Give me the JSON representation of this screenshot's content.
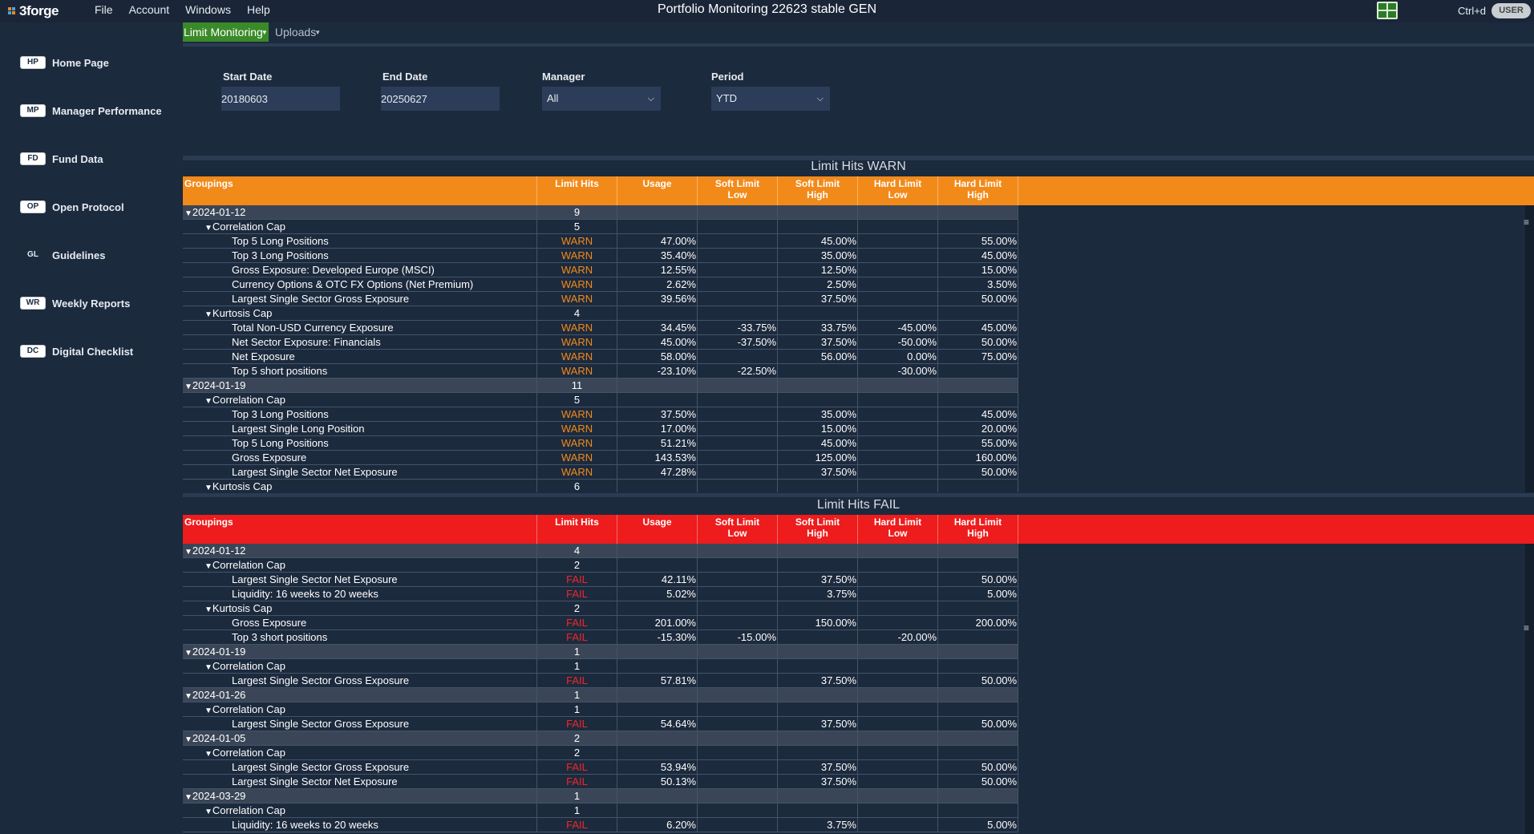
{
  "app": {
    "logo_text": "3forge",
    "title": "Portfolio Monitoring 22623 stable GEN",
    "menu": [
      "File",
      "Account",
      "Windows",
      "Help"
    ],
    "shortcut": "Ctrl+d",
    "user_label": "USER"
  },
  "sidebar": {
    "items": [
      {
        "badge": "HP",
        "label": "Home Page"
      },
      {
        "badge": "MP",
        "label": "Manager Performance"
      },
      {
        "badge": "FD",
        "label": "Fund Data"
      },
      {
        "badge": "OP",
        "label": "Open Protocol"
      },
      {
        "badge": "GL",
        "label": "Guidelines"
      },
      {
        "badge": "WR",
        "label": "Weekly Reports"
      },
      {
        "badge": "DC",
        "label": "Digital Checklist"
      }
    ]
  },
  "tabs": [
    {
      "label": "Limit Monitoring",
      "active": true
    },
    {
      "label": "Uploads",
      "active": false
    }
  ],
  "filters": {
    "start_date_label": "Start Date",
    "start_date": "20180603",
    "end_date_label": "End Date",
    "end_date": "20250627",
    "manager_label": "Manager",
    "manager": "All",
    "period_label": "Period",
    "period": "YTD"
  },
  "colors": {
    "warn_header": "#f28a1a",
    "fail_header": "#ee1c1c",
    "background": "#1c2a3d"
  },
  "columns": [
    "Groupings",
    "Limit Hits",
    "Usage",
    "Soft Limit\nLow",
    "Soft Limit\nHigh",
    "Hard Limit\nLow",
    "Hard Limit\nHigh"
  ],
  "warn": {
    "title": "Limit Hits WARN",
    "rows": [
      {
        "level": 0,
        "name": "2024-01-12",
        "hits": "9"
      },
      {
        "level": 1,
        "name": "Correlation Cap",
        "hits": "5"
      },
      {
        "level": 2,
        "name": "Top 5 Long Positions",
        "hits": "WARN",
        "usage": "47.00%",
        "sll": "",
        "slh": "45.00%",
        "hll": "",
        "hlh": "55.00%"
      },
      {
        "level": 2,
        "name": "Top 3 Long Positions",
        "hits": "WARN",
        "usage": "35.40%",
        "sll": "",
        "slh": "35.00%",
        "hll": "",
        "hlh": "45.00%"
      },
      {
        "level": 2,
        "name": "Gross Exposure: Developed Europe (MSCI)",
        "hits": "WARN",
        "usage": "12.55%",
        "sll": "",
        "slh": "12.50%",
        "hll": "",
        "hlh": "15.00%"
      },
      {
        "level": 2,
        "name": "Currency Options & OTC FX Options (Net Premium)",
        "hits": "WARN",
        "usage": "2.62%",
        "sll": "",
        "slh": "2.50%",
        "hll": "",
        "hlh": "3.50%"
      },
      {
        "level": 2,
        "name": "Largest Single Sector Gross Exposure",
        "hits": "WARN",
        "usage": "39.56%",
        "sll": "",
        "slh": "37.50%",
        "hll": "",
        "hlh": "50.00%"
      },
      {
        "level": 1,
        "name": "Kurtosis Cap",
        "hits": "4"
      },
      {
        "level": 2,
        "name": "Total Non-USD Currency Exposure",
        "hits": "WARN",
        "usage": "34.45%",
        "sll": "-33.75%",
        "slh": "33.75%",
        "hll": "-45.00%",
        "hlh": "45.00%"
      },
      {
        "level": 2,
        "name": "Net Sector Exposure: Financials",
        "hits": "WARN",
        "usage": "45.00%",
        "sll": "-37.50%",
        "slh": "37.50%",
        "hll": "-50.00%",
        "hlh": "50.00%"
      },
      {
        "level": 2,
        "name": "Net Exposure",
        "hits": "WARN",
        "usage": "58.00%",
        "sll": "",
        "slh": "56.00%",
        "hll": "0.00%",
        "hlh": "75.00%"
      },
      {
        "level": 2,
        "name": "Top 5 short positions",
        "hits": "WARN",
        "usage": "-23.10%",
        "sll": "-22.50%",
        "slh": "",
        "hll": "-30.00%",
        "hlh": ""
      },
      {
        "level": 0,
        "name": "2024-01-19",
        "hits": "11"
      },
      {
        "level": 1,
        "name": "Correlation Cap",
        "hits": "5"
      },
      {
        "level": 2,
        "name": "Top 3 Long Positions",
        "hits": "WARN",
        "usage": "37.50%",
        "sll": "",
        "slh": "35.00%",
        "hll": "",
        "hlh": "45.00%"
      },
      {
        "level": 2,
        "name": "Largest Single Long Position",
        "hits": "WARN",
        "usage": "17.00%",
        "sll": "",
        "slh": "15.00%",
        "hll": "",
        "hlh": "20.00%"
      },
      {
        "level": 2,
        "name": "Top 5 Long Positions",
        "hits": "WARN",
        "usage": "51.21%",
        "sll": "",
        "slh": "45.00%",
        "hll": "",
        "hlh": "55.00%"
      },
      {
        "level": 2,
        "name": "Gross Exposure",
        "hits": "WARN",
        "usage": "143.53%",
        "sll": "",
        "slh": "125.00%",
        "hll": "",
        "hlh": "160.00%"
      },
      {
        "level": 2,
        "name": "Largest Single Sector Net Exposure",
        "hits": "WARN",
        "usage": "47.28%",
        "sll": "",
        "slh": "37.50%",
        "hll": "",
        "hlh": "50.00%"
      },
      {
        "level": 1,
        "name": "Kurtosis Cap",
        "hits": "6"
      }
    ]
  },
  "fail": {
    "title": "Limit Hits FAIL",
    "rows": [
      {
        "level": 0,
        "name": "2024-01-12",
        "hits": "4"
      },
      {
        "level": 1,
        "name": "Correlation Cap",
        "hits": "2"
      },
      {
        "level": 2,
        "name": "Largest Single Sector Net Exposure",
        "hits": "FAIL",
        "usage": "42.11%",
        "sll": "",
        "slh": "37.50%",
        "hll": "",
        "hlh": "50.00%"
      },
      {
        "level": 2,
        "name": "Liquidity: 16 weeks to 20 weeks",
        "hits": "FAIL",
        "usage": "5.02%",
        "sll": "",
        "slh": "3.75%",
        "hll": "",
        "hlh": "5.00%"
      },
      {
        "level": 1,
        "name": "Kurtosis Cap",
        "hits": "2"
      },
      {
        "level": 2,
        "name": "Gross Exposure",
        "hits": "FAIL",
        "usage": "201.00%",
        "sll": "",
        "slh": "150.00%",
        "hll": "",
        "hlh": "200.00%"
      },
      {
        "level": 2,
        "name": "Top 3 short positions",
        "hits": "FAIL",
        "usage": "-15.30%",
        "sll": "-15.00%",
        "slh": "",
        "hll": "-20.00%",
        "hlh": ""
      },
      {
        "level": 0,
        "name": "2024-01-19",
        "hits": "1"
      },
      {
        "level": 1,
        "name": "Correlation Cap",
        "hits": "1"
      },
      {
        "level": 2,
        "name": "Largest Single Sector Gross Exposure",
        "hits": "FAIL",
        "usage": "57.81%",
        "sll": "",
        "slh": "37.50%",
        "hll": "",
        "hlh": "50.00%"
      },
      {
        "level": 0,
        "name": "2024-01-26",
        "hits": "1"
      },
      {
        "level": 1,
        "name": "Correlation Cap",
        "hits": "1"
      },
      {
        "level": 2,
        "name": "Largest Single Sector Gross Exposure",
        "hits": "FAIL",
        "usage": "54.64%",
        "sll": "",
        "slh": "37.50%",
        "hll": "",
        "hlh": "50.00%"
      },
      {
        "level": 0,
        "name": "2024-01-05",
        "hits": "2"
      },
      {
        "level": 1,
        "name": "Correlation Cap",
        "hits": "2"
      },
      {
        "level": 2,
        "name": "Largest Single Sector Gross Exposure",
        "hits": "FAIL",
        "usage": "53.94%",
        "sll": "",
        "slh": "37.50%",
        "hll": "",
        "hlh": "50.00%"
      },
      {
        "level": 2,
        "name": "Largest Single Sector Net Exposure",
        "hits": "FAIL",
        "usage": "50.13%",
        "sll": "",
        "slh": "37.50%",
        "hll": "",
        "hlh": "50.00%"
      },
      {
        "level": 0,
        "name": "2024-03-29",
        "hits": "1"
      },
      {
        "level": 1,
        "name": "Correlation Cap",
        "hits": "1"
      },
      {
        "level": 2,
        "name": "Liquidity: 16 weeks to 20 weeks",
        "hits": "FAIL",
        "usage": "6.20%",
        "sll": "",
        "slh": "3.75%",
        "hll": "",
        "hlh": "5.00%"
      }
    ]
  }
}
